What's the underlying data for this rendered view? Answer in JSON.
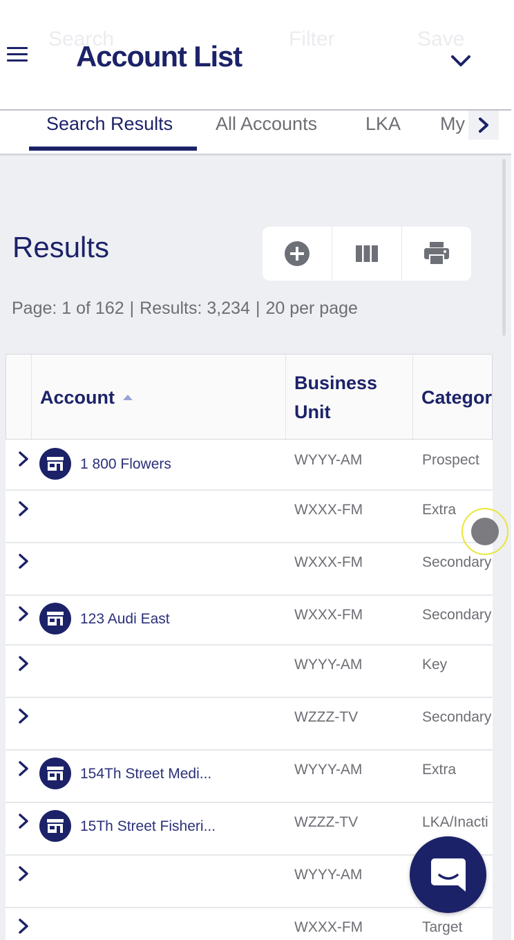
{
  "header": {
    "ghost_search": "Search",
    "ghost_filter": "Filter",
    "ghost_save": "Save",
    "title": "Account List"
  },
  "tabs": [
    {
      "label": "Search Results",
      "active": true
    },
    {
      "label": "All Accounts",
      "active": false
    },
    {
      "label": "LKA",
      "active": false
    },
    {
      "label": "My",
      "active": false
    }
  ],
  "results": {
    "title": "Results",
    "page_info": "Page: 1 of 162",
    "results_count": "Results: 3,234",
    "per_page": "20 per page",
    "separator": "|"
  },
  "toolbar": {
    "icons": [
      "add-icon",
      "columns-icon",
      "print-icon"
    ]
  },
  "table": {
    "columns": {
      "account": "Account",
      "business_unit_line1": "Business",
      "business_unit_line2": "Unit",
      "category": "Categor"
    },
    "rows": [
      {
        "account": "1 800 Flowers",
        "bu": "WYYY-AM",
        "category": "Prospect",
        "icon": true
      },
      {
        "account": "",
        "bu": "WXXX-FM",
        "category": "Extra",
        "icon": false
      },
      {
        "account": "",
        "bu": "WXXX-FM",
        "category": "Secondary",
        "icon": false
      },
      {
        "account": "123 Audi East",
        "bu": "WXXX-FM",
        "category": "Secondary",
        "icon": true
      },
      {
        "account": "",
        "bu": "WYYY-AM",
        "category": "Key",
        "icon": false
      },
      {
        "account": "",
        "bu": "WZZZ-TV",
        "category": "Secondary",
        "icon": false
      },
      {
        "account": "154Th Street Medi...",
        "bu": "WYYY-AM",
        "category": "Extra",
        "icon": true
      },
      {
        "account": "15Th Street Fisheri...",
        "bu": "WZZZ-TV",
        "category": "LKA/Inacti",
        "icon": true
      },
      {
        "account": "",
        "bu": "WYYY-AM",
        "category": "",
        "icon": false
      },
      {
        "account": "",
        "bu": "WXXX-FM",
        "category": "Target",
        "icon": false
      }
    ]
  },
  "colors": {
    "brand": "#1c2268",
    "muted_text": "#6d6e74",
    "background": "#eeeff2"
  }
}
